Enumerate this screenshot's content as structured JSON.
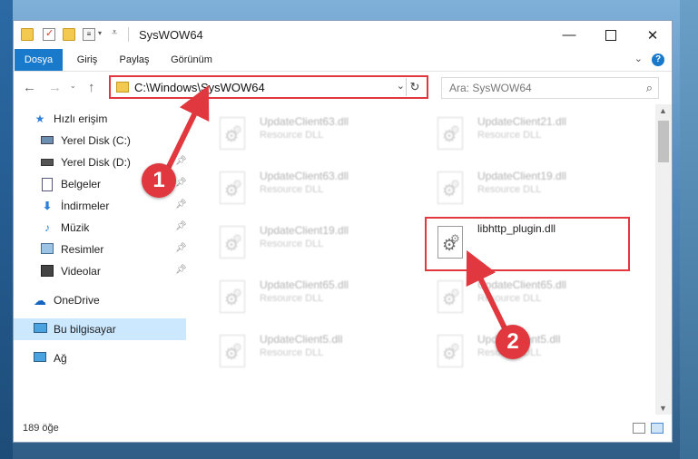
{
  "window": {
    "title": "SysWOW64",
    "minimize_icon": "minimize-icon",
    "maximize_icon": "maximize-icon",
    "close_icon": "close-icon"
  },
  "ribbon": {
    "tabs": [
      {
        "label": "Dosya",
        "active": true
      },
      {
        "label": "Giriş"
      },
      {
        "label": "Paylaş"
      },
      {
        "label": "Görünüm"
      }
    ],
    "help": "?"
  },
  "address": {
    "path": "C:\\Windows\\SysWOW64",
    "search_placeholder": "Ara: SysWOW64"
  },
  "sidebar": {
    "items": [
      {
        "label": "Hızlı erişim",
        "icon": "star-icon",
        "pinned": false
      },
      {
        "label": "Yerel Disk (C:)",
        "icon": "disk-icon",
        "pinned": false
      },
      {
        "label": "Yerel Disk (D:)",
        "icon": "disk-icon",
        "pinned": true
      },
      {
        "label": "Belgeler",
        "icon": "documents-icon",
        "pinned": true
      },
      {
        "label": "İndirmeler",
        "icon": "download-icon",
        "pinned": true
      },
      {
        "label": "Müzik",
        "icon": "music-icon",
        "pinned": true
      },
      {
        "label": "Resimler",
        "icon": "pictures-icon",
        "pinned": true
      },
      {
        "label": "Videolar",
        "icon": "video-icon",
        "pinned": true
      },
      {
        "label": "OneDrive",
        "icon": "cloud-icon",
        "pinned": false
      },
      {
        "label": "Bu bilgisayar",
        "icon": "computer-icon",
        "pinned": false,
        "selected": true
      },
      {
        "label": "Ağ",
        "icon": "network-icon",
        "pinned": false
      }
    ]
  },
  "files": [
    {
      "name": "UpdateClient63.dll",
      "type": "Resource DLL"
    },
    {
      "name": "UpdateClient21.dll",
      "type": "Resource DLL"
    },
    {
      "name": "UpdateClient63.dll",
      "type": "Resource DLL"
    },
    {
      "name": "UpdateClient19.dll",
      "type": "Resource DLL"
    },
    {
      "name": "UpdateClient19.dll",
      "type": "Resource DLL"
    },
    {
      "name": "libhttp_plugin.dll",
      "type": "",
      "highlighted": true
    },
    {
      "name": "UpdateClient65.dll",
      "type": "Resource DLL"
    },
    {
      "name": "UpdateClient65.dll",
      "type": "Resource DLL"
    },
    {
      "name": "UpdateClient5.dll",
      "type": "Resource DLL"
    },
    {
      "name": "UpdateClient5.dll",
      "type": "Resource DLL"
    }
  ],
  "status": {
    "item_count": "189 öğe"
  },
  "annotations": {
    "badge1": "1",
    "badge2": "2",
    "color": "#e0383e"
  }
}
